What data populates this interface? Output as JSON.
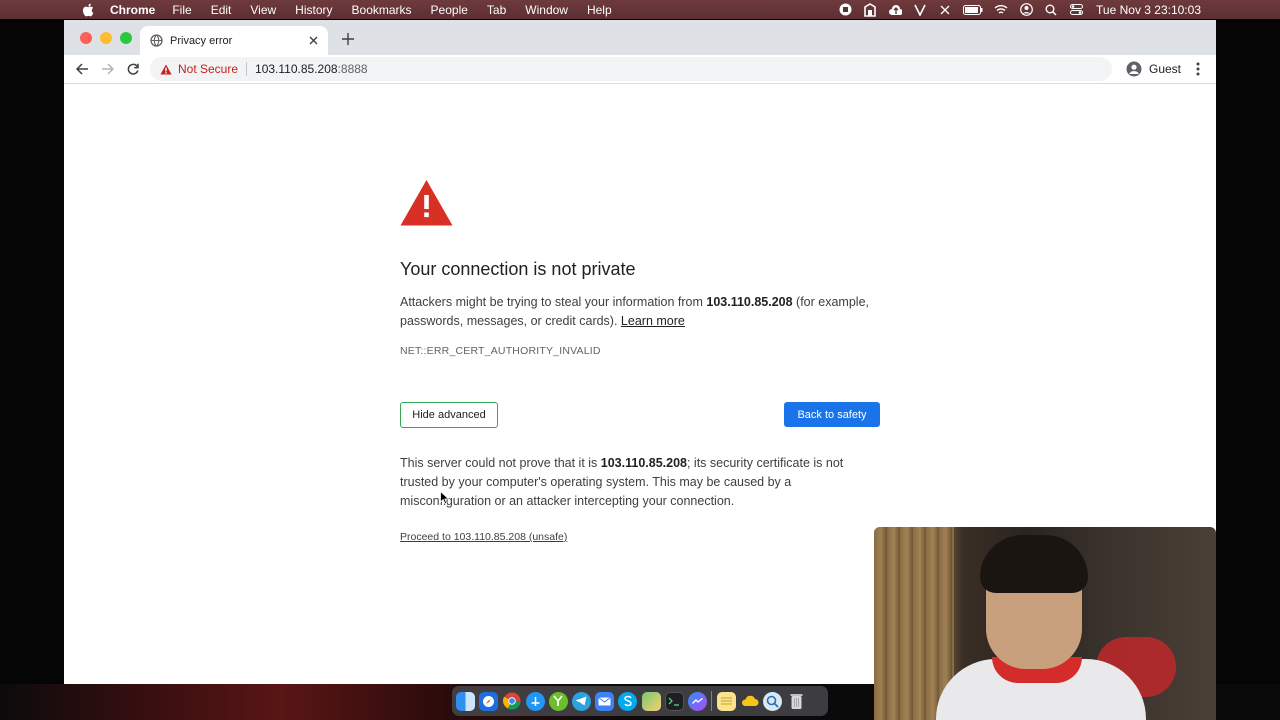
{
  "menubar": {
    "app_name": "Chrome",
    "items": [
      "File",
      "Edit",
      "View",
      "History",
      "Bookmarks",
      "People",
      "Tab",
      "Window",
      "Help"
    ],
    "clock": "Tue Nov 3  23:10:03",
    "status_icons": [
      "record-icon",
      "vpn-icon",
      "cloud-upload-icon",
      "v-icon",
      "x-icon",
      "battery-icon",
      "wifi-icon",
      "user-icon",
      "search-icon",
      "control-center-icon"
    ]
  },
  "browser": {
    "tab": {
      "title": "Privacy error"
    },
    "address": {
      "security_label": "Not Secure",
      "host": "103.110.85.208",
      "port": ":8888"
    },
    "profile_label": "Guest"
  },
  "page": {
    "heading": "Your connection is not private",
    "explain": {
      "prefix": "Attackers might be trying to steal your information from ",
      "host": "103.110.85.208",
      "suffix": " (for example, passwords, messages, or credit cards). ",
      "learn_more": "Learn more"
    },
    "error_code": "NET::ERR_CERT_AUTHORITY_INVALID",
    "hide_advanced_label": "Hide advanced",
    "back_to_safety_label": "Back to safety",
    "details": {
      "prefix": "This server could not prove that it is ",
      "host": "103.110.85.208",
      "suffix": "; its security certificate is not trusted by your computer's operating system. This may be caused by a misconfiguration or an attacker intercepting your connection."
    },
    "proceed_link": "Proceed to 103.110.85.208 (unsafe)"
  },
  "colors": {
    "warning_red": "#c5221f",
    "primary_blue": "#1a73e8",
    "focus_green": "#34a853"
  },
  "dock": {
    "apps": [
      "finder-icon",
      "safari-icon",
      "chrome-icon",
      "app-store-icon",
      "yandex-icon",
      "telegram-icon",
      "mail-icon",
      "skype-icon",
      "maps-icon",
      "terminal-icon",
      "messenger-icon",
      "notes-icon",
      "cloud-icon",
      "preview-icon",
      "trash-icon"
    ]
  }
}
